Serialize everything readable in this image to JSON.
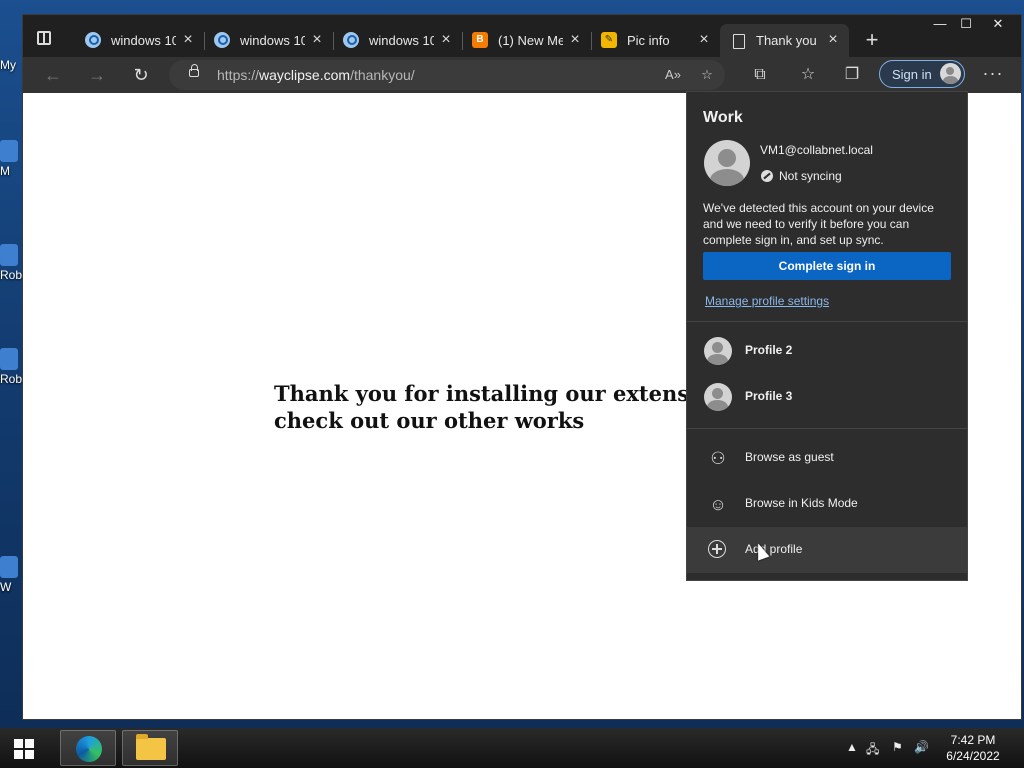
{
  "desktop": {
    "icons": [
      "My",
      "M",
      "Rob",
      "Rob",
      "W"
    ]
  },
  "browser": {
    "tabs": [
      {
        "label": "windows 10",
        "favicon": "search-favicon"
      },
      {
        "label": "windows 10",
        "favicon": "search-favicon"
      },
      {
        "label": "windows 10",
        "favicon": "search-favicon"
      },
      {
        "label": "(1) New Me",
        "favicon": "blogger-favicon"
      },
      {
        "label": "Pic info",
        "favicon": "pic-info-favicon"
      },
      {
        "label": "Thank you",
        "favicon": "page-favicon",
        "active": true
      }
    ],
    "new_tab": "+",
    "window_controls": {
      "minimize": "—",
      "maximize": "☐",
      "close": "✕"
    },
    "url": {
      "scheme": "https://",
      "domain": "wayclipse.com",
      "path": "/thankyou/"
    },
    "signin_label": "Sign in"
  },
  "page": {
    "message": "Thank you for installing our extension, check out our other works"
  },
  "profile_flyout": {
    "title": "Work",
    "email": "VM1@collabnet.local",
    "sync_status": "Not syncing",
    "verify_text": "We've detected this account on your device and we need to verify it before you can complete sign in, and set up sync.",
    "complete_button": "Complete sign in",
    "manage_link": "Manage profile settings",
    "profiles": [
      "Profile 2",
      "Profile 3"
    ],
    "actions": {
      "guest": "Browse as guest",
      "kids": "Browse in Kids Mode",
      "add": "Add profile"
    }
  },
  "taskbar": {
    "time": "7:42 PM",
    "date": "6/24/2022"
  },
  "colors": {
    "accent": "#0a66c2",
    "link": "#8ab8ea",
    "flyout_bg": "#2d2d2d"
  }
}
